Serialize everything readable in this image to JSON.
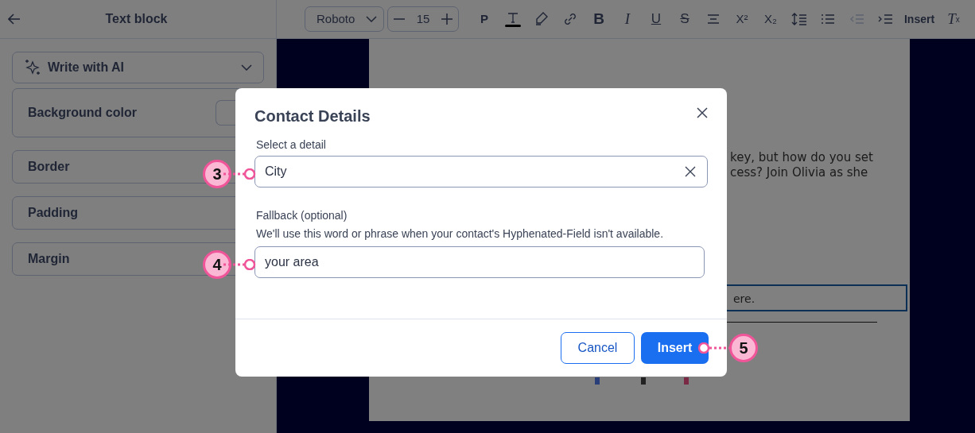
{
  "sidebar": {
    "title": "Text block",
    "ai_dropdown": "Write with AI",
    "sections": [
      {
        "label": "Background color",
        "kind": "color"
      },
      {
        "label": "Border",
        "kind": "collapsible"
      },
      {
        "label": "Padding",
        "kind": "collapsible"
      },
      {
        "label": "Margin",
        "kind": "collapsible"
      }
    ]
  },
  "toolbar": {
    "font": "Roboto",
    "font_size": "15",
    "items": [
      {
        "kind": "text",
        "label": "P",
        "disabled": false
      },
      {
        "kind": "text-color",
        "disabled": false
      },
      {
        "kind": "highlight",
        "disabled": false
      },
      {
        "kind": "link",
        "disabled": false
      },
      {
        "kind": "bold",
        "label": "B",
        "disabled": false
      },
      {
        "kind": "italic",
        "label": "I",
        "disabled": false
      },
      {
        "kind": "underline",
        "label": "U",
        "disabled": false
      },
      {
        "kind": "strike",
        "label": "S",
        "disabled": false
      },
      {
        "kind": "align",
        "disabled": false
      },
      {
        "kind": "text",
        "label": "X²",
        "disabled": false
      },
      {
        "kind": "text",
        "label": "X₂",
        "disabled": false
      },
      {
        "kind": "line-height",
        "disabled": false
      },
      {
        "kind": "list",
        "disabled": false
      },
      {
        "kind": "outdent",
        "disabled": true
      },
      {
        "kind": "indent",
        "disabled": false
      },
      {
        "kind": "text",
        "label": "Insert",
        "disabled": false
      },
      {
        "kind": "clear",
        "label": "T",
        "sub": "x",
        "disabled": false
      }
    ]
  },
  "canvas": {
    "paragraph_lines": [
      "key, but how do you set",
      "cess? Join Olivia as she"
    ],
    "boxed_text": "ere."
  },
  "dialog": {
    "title": "Contact Details",
    "detail_label": "Select a detail",
    "detail_value": "City",
    "fallback_label": "Fallback (optional)",
    "fallback_help": "We'll use this word or phrase when your contact's Hyphenated-Field isn't available.",
    "fallback_value": "your area",
    "buttons": [
      {
        "label": "Cancel",
        "kind": "secondary"
      },
      {
        "label": "Insert",
        "kind": "primary"
      }
    ]
  },
  "callouts": [
    {
      "label": "3"
    },
    {
      "label": "4"
    },
    {
      "label": "5"
    }
  ]
}
